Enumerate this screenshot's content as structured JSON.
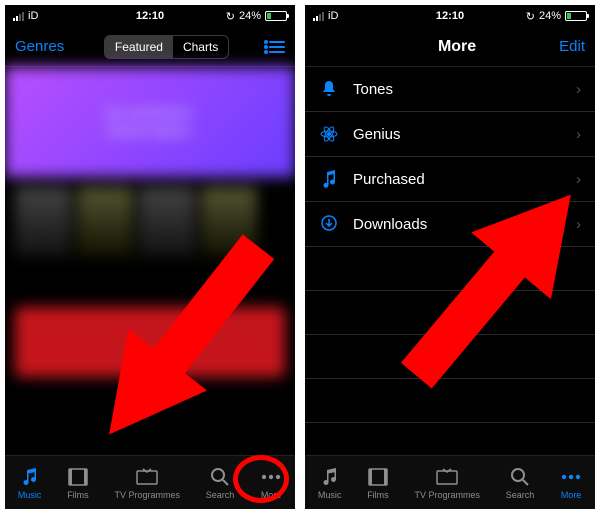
{
  "status": {
    "carrier": "iD",
    "time": "12:10",
    "battery_pct": "24%"
  },
  "left": {
    "nav_genres": "Genres",
    "seg_featured": "Featured",
    "seg_charts": "Charts",
    "banner_line1": "No commitment.",
    "banner_line2": "Cancel anytime."
  },
  "right": {
    "title": "More",
    "edit": "Edit",
    "items": [
      {
        "label": "Tones"
      },
      {
        "label": "Genius"
      },
      {
        "label": "Purchased"
      },
      {
        "label": "Downloads"
      }
    ]
  },
  "tabs": {
    "music": "Music",
    "films": "Films",
    "tv": "TV Programmes",
    "search": "Search",
    "more": "More"
  },
  "annotation": {
    "arrow_color": "#ff0000"
  }
}
